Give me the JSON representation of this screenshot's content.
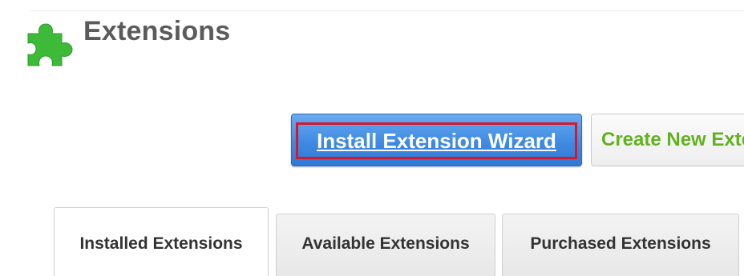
{
  "header": {
    "title": "Extensions",
    "icon": "puzzle-piece-icon",
    "icon_color": "#3dbb38"
  },
  "actions": {
    "install_wizard_label": "Install Extension Wizard",
    "create_new_label": "Create New Exte",
    "install_wizard_color": "#3f8ae3",
    "focus_outline_color": "#d7182a",
    "create_new_color": "#62b21f"
  },
  "tabs": [
    {
      "label": "Installed Extensions",
      "active": true
    },
    {
      "label": "Available Extensions",
      "active": false
    },
    {
      "label": "Purchased Extensions",
      "active": false
    }
  ]
}
